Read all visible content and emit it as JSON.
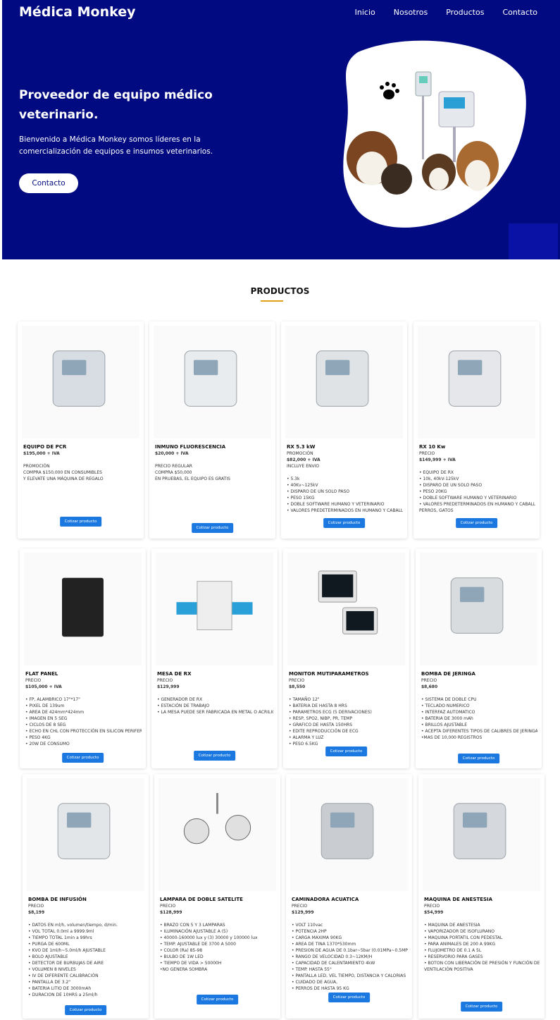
{
  "header": {
    "brand": "Médica Monkey",
    "nav": [
      "Inicio",
      "Nosotros",
      "Productos",
      "Contacto"
    ]
  },
  "hero": {
    "title": "Proveedor de equipo médico veterinario.",
    "text": "Bienvenido a Médica Monkey somos líderes en la comercialización de equipos e insumos veterinarios.",
    "button": "Contacto"
  },
  "section": {
    "title": "PRODUCTOS"
  },
  "colors": {
    "hero_bg": "#010a80",
    "button": "#1a78e0",
    "accent": "#e3a018"
  },
  "products": [
    {
      "name": "EQUIPO DE PCR",
      "lines": [
        "$195,000 + IVA",
        "",
        "PROMOCIÓN",
        "COMPRA $150,000 EN CONSUMIBLES",
        "Y ELEVATE UNA MÁQUINA DE REGALO"
      ],
      "button": "Cotizar producto"
    },
    {
      "name": "INMUNO FLUORESCENCIA",
      "lines": [
        "$20,000 + IVA",
        "",
        "PRECIO REGULAR",
        "COMPRA $50,000",
        "EN PRUEBAS, EL EQUIPO ES GRATIS"
      ],
      "button": "Cotizar producto"
    },
    {
      "name": "RX 5.3 kW",
      "lines": [
        "PROMOCIÓN",
        "$82,000 + IVA",
        "INCLUYE ENVIO",
        "",
        "• 5.3k",
        "• 40Kv~125kV",
        "• DISPARO DE UN SOLO PASO",
        "• PESO 15KG",
        "• DOBLE SOFTWARE HUMANO Y VETERINARIO",
        "• VALORES PREDETERMINADOS EN HUMANO Y CABALLOS"
      ],
      "button": "Cotizar producto"
    },
    {
      "name": "RX 10 Kw",
      "lines": [
        "PRECIO",
        "$149,999 + IVA",
        "",
        "• EQUIPO DE RX",
        "• 10k, 40kV-125kV",
        "• DISPARO DE UN SOLO PASO",
        "• PESO 20KG",
        "• DOBLE SOFTWARE HUMANO Y VETERINARIO",
        "• VALORES PREDETERMINADOS EN HUMANO Y CABALLOS,",
        "PERROS, GATOS"
      ],
      "button": "Cotizar producto"
    },
    {
      "name": "FLAT PANEL",
      "lines": [
        "PRECIO",
        "$105,000 + IVA",
        "",
        "• FP, ALAMBRICO 17\"*17\"",
        "• PIXEL DE 139um",
        "• AREA DE 424mm*424mm",
        "• IMAGEN EN 5 SEG",
        "• CICLOS DE 8 SEG",
        "• ECHO EN CHL CON PROTECCIÓN EN SILICON PERIFERICA",
        "• PESO 4KG",
        "• 20W DE CONSUMO"
      ],
      "button": "Cotizar producto"
    },
    {
      "name": "MESA DE RX",
      "lines": [
        "PRECIO",
        "$129,999",
        "",
        "• GENERADOR DE RX",
        "• ESTACIÓN DE TRABAJO",
        "• LA MESA PUEDE SER FABRICADA EN METAL O ACRILICO"
      ],
      "button": "Cotizar producto"
    },
    {
      "name": "MONITOR MUTIPARAMETROS",
      "lines": [
        "PRECIO",
        "$8,550",
        "",
        "• TAMAÑO 12\"",
        "• BATERIA DE HASTA 8 HRS",
        "• PARAMETROS ECG (5 DERIVACIONES)",
        "• RESP, SPO2, NIBP, PR, TEMP",
        "• GRAFICO DE HASTA 150HRS",
        "• EDITE REPRODUCCIÓN DE ECG",
        "• ALARMA Y LUZ",
        "• PESO 6.5KG"
      ],
      "button": "Cotizar producto"
    },
    {
      "name": "BOMBA DE JERINGA",
      "lines": [
        "PRECIO",
        "$8,680",
        "",
        "• SISTEMA DE DOBLE CPU",
        "• TECLADO NUMERICO",
        "• INTERFAZ AUTOMATICO",
        "• BATERIA DE 3000 mAh",
        "• BRILLOS AJUSTABLE",
        "• ACEPTA DIFERENTES TIPOS DE CALIBRES DE JERINGA",
        "•MAS DE 10,000 REGISTROS"
      ],
      "button": "Cotizar producto"
    },
    {
      "name": "BOMBA DE INFUSIÓN",
      "lines": [
        "PRECIO",
        "$8,199",
        "",
        "• DATOS EN ml/h, volumen/tiempo, d/min.",
        "• VOL TOTAL 0.0ml a 9999.9ml",
        "• TIEMPO TOTAL 1min a 99hrs",
        "• PURGA DE 600ML",
        "• KVO DE 1ml/h~5.0ml/h AJUSTABLE",
        "• BOLO AJUSTABLE",
        "• DETECTOR DE BURBUJAS DE AIRE",
        "• VOLUMEN 8 NIVELES",
        "• IV DE DIFERENTE CALIBRACIÓN",
        "• PANTALLA DE 3.2\"",
        "• BATERIA LITIO DE 3000mAh",
        "• DURACION DE 10HRS a 25ml/h"
      ],
      "button": "Cotizar producto"
    },
    {
      "name": "LAMPARA DE DOBLE SATELITE",
      "lines": [
        "PRECIO",
        "$128,999",
        "",
        "• BRAZO CON 5 Y 3 LAMPARAS",
        "• ILUMINACIÓN AJUSTABLE A (5)",
        "• 40000-160000 lux y (3) 30000 y 100000 lux",
        "• TEMP. AJUSTABLE DE 3700 A 5000",
        "• COLOR (Ra) 85-98",
        "• BULBO DE 1W LED",
        "• TIEMPO DE VIDA > 50000H",
        "•NO GENERA SOMBRA"
      ],
      "button": "Cotizar producto"
    },
    {
      "name": "CAMINADORA ACUATICA",
      "lines": [
        "PRECIO",
        "$129,999",
        "",
        "• VOLT 110vac",
        "• POTENCIA 2HP",
        "• CARGA MAXIMA 90KG",
        "• AREA DE TINA 1370*530mm",
        "• PRESION DE AGUA DE 0.1bar~5bar (0.01MPa~0.5MPa)",
        "• RANGO DE VELOCIDAD 0.3~12KM/H",
        "• CAPACIDAD DE CALENTAMIENTO 4kW",
        "• TEMP. HASTA 55°",
        "• PANTALLA LED, VEL TIEMPO, DISTANCIA Y CALORIAS",
        "• CUIDADO DE AGUA,",
        "• PERROS DE HASTA 95 KG"
      ],
      "button": "Cotizar producto"
    },
    {
      "name": "MAQUINA DE ANESTESIA",
      "lines": [
        "PRECIO",
        "$54,999",
        "",
        "• MAQUINA DE ANESTESIA",
        "• VAPORIZADOR DE ISOFLURANO",
        "• MAQUINA PORTATIL CON PEDESTAL",
        "• PARA ANIMALES DE 200 A 99KG",
        "• FLUJOMETRO DE 0.1 A 5L",
        "• RESERVORIO PARA GASES",
        "• BOTON CON LIBERACIÓN DE PRESIÓN Y FUNCIÓN DE",
        "VENTILACIÓN POSITIVA"
      ],
      "button": "Cotizar producto"
    }
  ]
}
